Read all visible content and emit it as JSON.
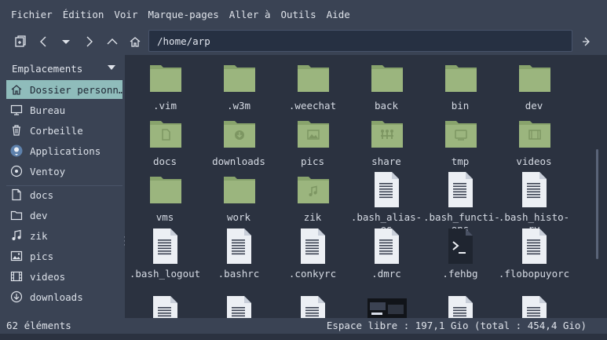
{
  "menubar": {
    "items": [
      "Fichier",
      "Édition",
      "Voir",
      "Marque-pages",
      "Aller à",
      "Outils",
      "Aide"
    ]
  },
  "toolbar": {
    "location": "/home/arp"
  },
  "sidebar": {
    "header": "Emplacements",
    "places": [
      {
        "label": "Dossier personn…",
        "icon": "home-icon"
      },
      {
        "label": "Bureau",
        "icon": "desktop-icon"
      },
      {
        "label": "Corbeille",
        "icon": "trash-icon"
      },
      {
        "label": "Applications",
        "icon": "applications-icon"
      },
      {
        "label": "Ventoy",
        "icon": "drive-icon"
      }
    ],
    "bookmarks": [
      {
        "label": "docs",
        "icon": "document-icon"
      },
      {
        "label": "dev",
        "icon": "folder-icon"
      },
      {
        "label": "zik",
        "icon": "music-icon"
      },
      {
        "label": "pics",
        "icon": "image-icon"
      },
      {
        "label": "videos",
        "icon": "film-icon"
      },
      {
        "label": "downloads",
        "icon": "download-icon"
      }
    ]
  },
  "files": [
    {
      "name": ".vim",
      "type": "folder"
    },
    {
      "name": ".w3m",
      "type": "folder"
    },
    {
      "name": ".weechat",
      "type": "folder"
    },
    {
      "name": "back",
      "type": "folder"
    },
    {
      "name": "bin",
      "type": "folder"
    },
    {
      "name": "dev",
      "type": "folder"
    },
    {
      "name": "docs",
      "type": "folder-docs"
    },
    {
      "name": "downloads",
      "type": "folder-downloads"
    },
    {
      "name": "pics",
      "type": "folder-pics"
    },
    {
      "name": "share",
      "type": "folder-share"
    },
    {
      "name": "tmp",
      "type": "folder-tmp"
    },
    {
      "name": "videos",
      "type": "folder-videos"
    },
    {
      "name": "vms",
      "type": "folder"
    },
    {
      "name": "work",
      "type": "folder"
    },
    {
      "name": "zik",
      "type": "folder-music"
    },
    {
      "name": ".bash_alias-\nes",
      "type": "text"
    },
    {
      "name": ".bash_functi-\nons",
      "type": "text"
    },
    {
      "name": ".bash_histo-\nry",
      "type": "text"
    },
    {
      "name": ".bash_logout",
      "type": "text"
    },
    {
      "name": ".bashrc",
      "type": "text"
    },
    {
      "name": ".conkyrc",
      "type": "text"
    },
    {
      "name": ".dmrc",
      "type": "text"
    },
    {
      "name": ".fehbg",
      "type": "script"
    },
    {
      "name": ".flobopuyorc",
      "type": "text"
    },
    {
      "name": "",
      "type": "text"
    },
    {
      "name": "",
      "type": "text"
    },
    {
      "name": "",
      "type": "text"
    },
    {
      "name": "",
      "type": "thumbnail"
    },
    {
      "name": "",
      "type": "text"
    },
    {
      "name": "",
      "type": "text"
    }
  ],
  "status": {
    "count": "62 éléments",
    "free_space": "Espace libre : 197,1 Gio (total : 454,4 Gio)"
  },
  "colors": {
    "folder": "#9bb57e",
    "folder_dark": "#88a36c",
    "selection": "#8fbcbb",
    "panel": "#3a4354",
    "background": "#2b3240"
  }
}
